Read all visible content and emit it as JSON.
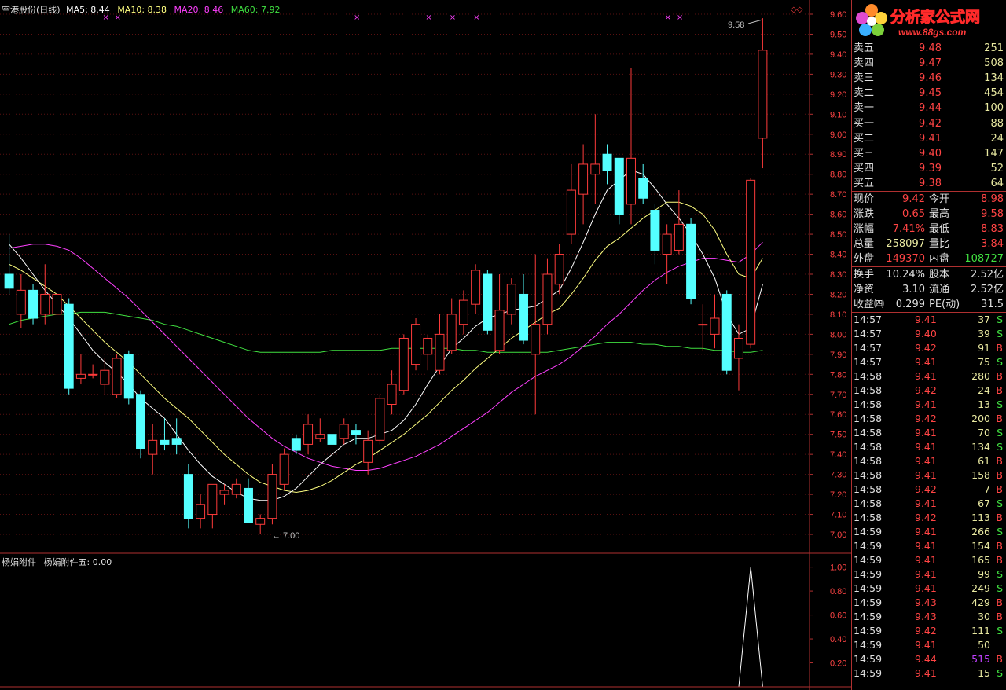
{
  "header": {
    "title": "空港股份(日线)",
    "ma5": "MA5: 8.44",
    "ma10": "MA10: 8.38",
    "ma20": "MA20: 8.46",
    "ma60": "MA60: 7.92",
    "ma5_color": "#ffffff",
    "ma10_color": "#ffff80",
    "ma20_color": "#ff40ff",
    "ma60_color": "#40e040"
  },
  "sub_header": {
    "indicator": "杨娟附件",
    "value": "杨娟附件五: 0.00"
  },
  "price_axis": [
    "9.60",
    "9.50",
    "9.40",
    "9.30",
    "9.20",
    "9.10",
    "9.00",
    "8.90",
    "8.80",
    "8.70",
    "8.60",
    "8.50",
    "8.40",
    "8.30",
    "8.20",
    "8.10",
    "8.00",
    "7.90",
    "7.80",
    "7.70",
    "7.60",
    "7.50",
    "7.40",
    "7.30",
    "7.20",
    "7.10",
    "7.00"
  ],
  "sub_axis": [
    "1.00",
    "0.80",
    "0.60",
    "0.40",
    "0.20"
  ],
  "annotations": {
    "high": "9.58",
    "low": "7.00"
  },
  "logo": {
    "text": "分析家公式网",
    "url": "www.88gs.com"
  },
  "order_book": {
    "asks": [
      {
        "label": "卖五",
        "price": "9.48",
        "qty": "251"
      },
      {
        "label": "卖四",
        "price": "9.47",
        "qty": "508"
      },
      {
        "label": "卖三",
        "price": "9.46",
        "qty": "134"
      },
      {
        "label": "卖二",
        "price": "9.45",
        "qty": "454"
      },
      {
        "label": "卖一",
        "price": "9.44",
        "qty": "100"
      }
    ],
    "bids": [
      {
        "label": "买一",
        "price": "9.42",
        "qty": "88"
      },
      {
        "label": "买二",
        "price": "9.41",
        "qty": "24"
      },
      {
        "label": "买三",
        "price": "9.40",
        "qty": "147"
      },
      {
        "label": "买四",
        "price": "9.39",
        "qty": "52"
      },
      {
        "label": "买五",
        "price": "9.38",
        "qty": "64"
      }
    ]
  },
  "quote": [
    {
      "l": "现价",
      "lv": "9.42",
      "lc": "#ff4444",
      "r": "今开",
      "rv": "8.98",
      "rc": "#ff4444"
    },
    {
      "l": "涨跌",
      "lv": "0.65",
      "lc": "#ff4444",
      "r": "最高",
      "rv": "9.58",
      "rc": "#ff4444"
    },
    {
      "l": "涨幅",
      "lv": "7.41%",
      "lc": "#ff4444",
      "r": "最低",
      "rv": "8.83",
      "rc": "#ff4444"
    },
    {
      "l": "总量",
      "lv": "258097",
      "lc": "#e8e8a0",
      "r": "量比",
      "rv": "3.84",
      "rc": "#ff4444"
    },
    {
      "l": "外盘",
      "lv": "149370",
      "lc": "#ff4444",
      "r": "内盘",
      "rv": "108727",
      "rc": "#40e040"
    }
  ],
  "fundamentals": [
    {
      "l": "换手",
      "lv": "10.24%",
      "lc": "#e0e0e0",
      "r": "股本",
      "rv": "2.52亿",
      "rc": "#e0e0e0"
    },
    {
      "l": "净资",
      "lv": "3.10",
      "lc": "#e0e0e0",
      "r": "流通",
      "rv": "2.52亿",
      "rc": "#e0e0e0"
    },
    {
      "l": "收益㈣",
      "lv": "0.299",
      "lc": "#e0e0e0",
      "r": "PE(动)",
      "rv": "31.5",
      "rc": "#e0e0e0"
    }
  ],
  "ticks": [
    {
      "time": "14:57",
      "price": "9.41",
      "vol": "37",
      "side": "S"
    },
    {
      "time": "14:57",
      "price": "9.40",
      "vol": "39",
      "side": "S"
    },
    {
      "time": "14:57",
      "price": "9.42",
      "vol": "91",
      "side": "B"
    },
    {
      "time": "14:57",
      "price": "9.41",
      "vol": "75",
      "side": "S"
    },
    {
      "time": "14:58",
      "price": "9.41",
      "vol": "280",
      "side": "B"
    },
    {
      "time": "14:58",
      "price": "9.42",
      "vol": "24",
      "side": "B"
    },
    {
      "time": "14:58",
      "price": "9.41",
      "vol": "13",
      "side": "S"
    },
    {
      "time": "14:58",
      "price": "9.42",
      "vol": "200",
      "side": "B"
    },
    {
      "time": "14:58",
      "price": "9.41",
      "vol": "70",
      "side": "S"
    },
    {
      "time": "14:58",
      "price": "9.41",
      "vol": "134",
      "side": "S"
    },
    {
      "time": "14:58",
      "price": "9.41",
      "vol": "61",
      "side": "B"
    },
    {
      "time": "14:58",
      "price": "9.41",
      "vol": "158",
      "side": "B"
    },
    {
      "time": "14:58",
      "price": "9.42",
      "vol": "7",
      "side": "B"
    },
    {
      "time": "14:58",
      "price": "9.41",
      "vol": "67",
      "side": "S"
    },
    {
      "time": "14:58",
      "price": "9.42",
      "vol": "113",
      "side": "B"
    },
    {
      "time": "14:59",
      "price": "9.41",
      "vol": "266",
      "side": "S"
    },
    {
      "time": "14:59",
      "price": "9.41",
      "vol": "154",
      "side": "B"
    },
    {
      "time": "14:59",
      "price": "9.41",
      "vol": "165",
      "side": "B"
    },
    {
      "time": "14:59",
      "price": "9.41",
      "vol": "99",
      "side": "S"
    },
    {
      "time": "14:59",
      "price": "9.41",
      "vol": "249",
      "side": "S"
    },
    {
      "time": "14:59",
      "price": "9.43",
      "vol": "429",
      "side": "B"
    },
    {
      "time": "14:59",
      "price": "9.43",
      "vol": "30",
      "side": "B"
    },
    {
      "time": "14:59",
      "price": "9.42",
      "vol": "111",
      "side": "S"
    },
    {
      "time": "14:59",
      "price": "9.41",
      "vol": "50",
      "side": ""
    },
    {
      "time": "14:59",
      "price": "9.44",
      "vol": "515",
      "side": "B"
    },
    {
      "time": "14:59",
      "price": "9.41",
      "vol": "15",
      "side": "S"
    }
  ],
  "chart_data": {
    "type": "candlestick",
    "ylim": [
      7.0,
      9.6
    ],
    "candles": [
      {
        "o": 8.3,
        "h": 8.5,
        "l": 8.2,
        "c": 8.23
      },
      {
        "o": 8.1,
        "h": 8.3,
        "l": 8.03,
        "c": 8.22
      },
      {
        "o": 8.22,
        "h": 8.25,
        "l": 8.05,
        "c": 8.08
      },
      {
        "o": 8.1,
        "h": 8.35,
        "l": 8.05,
        "c": 8.2
      },
      {
        "o": 8.1,
        "h": 8.25,
        "l": 8.0,
        "c": 8.2
      },
      {
        "o": 8.15,
        "h": 8.18,
        "l": 7.7,
        "c": 7.73
      },
      {
        "o": 7.78,
        "h": 7.9,
        "l": 7.75,
        "c": 7.8
      },
      {
        "o": 7.8,
        "h": 7.85,
        "l": 7.78,
        "c": 7.8
      },
      {
        "o": 7.75,
        "h": 7.88,
        "l": 7.7,
        "c": 7.82
      },
      {
        "o": 7.7,
        "h": 7.9,
        "l": 7.68,
        "c": 7.88
      },
      {
        "o": 7.9,
        "h": 7.92,
        "l": 7.65,
        "c": 7.68
      },
      {
        "o": 7.7,
        "h": 7.72,
        "l": 7.38,
        "c": 7.43
      },
      {
        "o": 7.4,
        "h": 7.55,
        "l": 7.3,
        "c": 7.47
      },
      {
        "o": 7.47,
        "h": 7.58,
        "l": 7.42,
        "c": 7.45
      },
      {
        "o": 7.48,
        "h": 7.58,
        "l": 7.4,
        "c": 7.45
      },
      {
        "o": 7.3,
        "h": 7.35,
        "l": 7.03,
        "c": 7.08
      },
      {
        "o": 7.08,
        "h": 7.2,
        "l": 7.03,
        "c": 7.15
      },
      {
        "o": 7.1,
        "h": 7.25,
        "l": 7.03,
        "c": 7.25
      },
      {
        "o": 7.2,
        "h": 7.25,
        "l": 7.15,
        "c": 7.22
      },
      {
        "o": 7.2,
        "h": 7.28,
        "l": 7.18,
        "c": 7.25
      },
      {
        "o": 7.23,
        "h": 7.28,
        "l": 7.06,
        "c": 7.06
      },
      {
        "o": 7.05,
        "h": 7.1,
        "l": 7.0,
        "c": 7.08
      },
      {
        "o": 7.08,
        "h": 7.35,
        "l": 7.05,
        "c": 7.3
      },
      {
        "o": 7.25,
        "h": 7.43,
        "l": 7.22,
        "c": 7.4
      },
      {
        "o": 7.48,
        "h": 7.5,
        "l": 7.4,
        "c": 7.42
      },
      {
        "o": 7.45,
        "h": 7.6,
        "l": 7.4,
        "c": 7.55
      },
      {
        "o": 7.48,
        "h": 7.58,
        "l": 7.46,
        "c": 7.5
      },
      {
        "o": 7.5,
        "h": 7.52,
        "l": 7.44,
        "c": 7.45
      },
      {
        "o": 7.48,
        "h": 7.58,
        "l": 7.45,
        "c": 7.55
      },
      {
        "o": 7.52,
        "h": 7.55,
        "l": 7.45,
        "c": 7.5
      },
      {
        "o": 7.36,
        "h": 7.52,
        "l": 7.3,
        "c": 7.47
      },
      {
        "o": 7.47,
        "h": 7.7,
        "l": 7.45,
        "c": 7.68
      },
      {
        "o": 7.65,
        "h": 7.82,
        "l": 7.6,
        "c": 7.75
      },
      {
        "o": 7.72,
        "h": 8.0,
        "l": 7.7,
        "c": 7.98
      },
      {
        "o": 7.85,
        "h": 8.08,
        "l": 7.82,
        "c": 8.05
      },
      {
        "o": 7.9,
        "h": 8.0,
        "l": 7.82,
        "c": 7.98
      },
      {
        "o": 7.82,
        "h": 8.1,
        "l": 7.8,
        "c": 8.0
      },
      {
        "o": 7.92,
        "h": 8.18,
        "l": 7.9,
        "c": 8.1
      },
      {
        "o": 8.05,
        "h": 8.22,
        "l": 8.0,
        "c": 8.17
      },
      {
        "o": 8.15,
        "h": 8.35,
        "l": 8.1,
        "c": 8.32
      },
      {
        "o": 8.3,
        "h": 8.32,
        "l": 8.0,
        "c": 8.02
      },
      {
        "o": 7.92,
        "h": 8.3,
        "l": 7.9,
        "c": 8.12
      },
      {
        "o": 8.1,
        "h": 8.28,
        "l": 8.05,
        "c": 8.25
      },
      {
        "o": 8.2,
        "h": 8.3,
        "l": 7.95,
        "c": 7.97
      },
      {
        "o": 7.9,
        "h": 8.4,
        "l": 7.6,
        "c": 8.05
      },
      {
        "o": 8.05,
        "h": 8.38,
        "l": 8.0,
        "c": 8.3
      },
      {
        "o": 8.25,
        "h": 8.45,
        "l": 8.2,
        "c": 8.4
      },
      {
        "o": 8.5,
        "h": 8.85,
        "l": 8.45,
        "c": 8.72
      },
      {
        "o": 8.7,
        "h": 8.95,
        "l": 8.55,
        "c": 8.85
      },
      {
        "o": 8.8,
        "h": 9.1,
        "l": 8.65,
        "c": 8.85
      },
      {
        "o": 8.9,
        "h": 8.95,
        "l": 8.75,
        "c": 8.82
      },
      {
        "o": 8.88,
        "h": 8.88,
        "l": 8.55,
        "c": 8.6
      },
      {
        "o": 8.65,
        "h": 9.33,
        "l": 8.55,
        "c": 8.88
      },
      {
        "o": 8.78,
        "h": 8.85,
        "l": 8.65,
        "c": 8.68
      },
      {
        "o": 8.62,
        "h": 8.65,
        "l": 8.35,
        "c": 8.42
      },
      {
        "o": 8.4,
        "h": 8.55,
        "l": 8.25,
        "c": 8.5
      },
      {
        "o": 8.42,
        "h": 8.72,
        "l": 8.4,
        "c": 8.55
      },
      {
        "o": 8.55,
        "h": 8.58,
        "l": 8.15,
        "c": 8.18
      },
      {
        "o": 8.05,
        "h": 8.15,
        "l": 7.92,
        "c": 8.05
      },
      {
        "o": 8.0,
        "h": 8.2,
        "l": 7.93,
        "c": 8.08
      },
      {
        "o": 8.2,
        "h": 8.22,
        "l": 7.8,
        "c": 7.82
      },
      {
        "o": 7.88,
        "h": 8.05,
        "l": 7.72,
        "c": 7.98
      },
      {
        "o": 7.95,
        "h": 8.78,
        "l": 7.93,
        "c": 8.77
      },
      {
        "o": 8.98,
        "h": 9.58,
        "l": 8.83,
        "c": 9.42
      }
    ],
    "ma5": [
      8.45,
      8.38,
      8.3,
      8.22,
      8.15,
      8.08,
      8.0,
      7.92,
      7.86,
      7.81,
      7.75,
      7.68,
      7.63,
      7.58,
      7.5,
      7.42,
      7.35,
      7.29,
      7.25,
      7.21,
      7.18,
      7.17,
      7.17,
      7.19,
      7.23,
      7.29,
      7.35,
      7.4,
      7.45,
      7.48,
      7.48,
      7.5,
      7.52,
      7.57,
      7.65,
      7.75,
      7.84,
      7.93,
      7.98,
      8.04,
      8.08,
      8.1,
      8.12,
      8.13,
      8.14,
      8.18,
      8.22,
      8.33,
      8.46,
      8.6,
      8.72,
      8.77,
      8.82,
      8.8,
      8.73,
      8.65,
      8.58,
      8.5,
      8.4,
      8.28,
      8.1,
      8.0,
      8.03,
      8.25
    ],
    "ma10": [
      8.35,
      8.32,
      8.28,
      8.24,
      8.2,
      8.14,
      8.08,
      8.02,
      7.96,
      7.91,
      7.86,
      7.8,
      7.74,
      7.68,
      7.63,
      7.58,
      7.52,
      7.46,
      7.4,
      7.35,
      7.3,
      7.26,
      7.24,
      7.22,
      7.21,
      7.22,
      7.24,
      7.27,
      7.31,
      7.35,
      7.38,
      7.42,
      7.46,
      7.5,
      7.55,
      7.6,
      7.66,
      7.72,
      7.77,
      7.83,
      7.88,
      7.93,
      7.98,
      8.02,
      8.06,
      8.1,
      8.13,
      8.2,
      8.28,
      8.37,
      8.44,
      8.48,
      8.53,
      8.58,
      8.62,
      8.66,
      8.66,
      8.64,
      8.6,
      8.52,
      8.4,
      8.3,
      8.28,
      8.38
    ],
    "ma20": [
      8.43,
      8.44,
      8.45,
      8.45,
      8.44,
      8.42,
      8.38,
      8.33,
      8.28,
      8.23,
      8.18,
      8.12,
      8.06,
      8.0,
      7.94,
      7.88,
      7.82,
      7.76,
      7.7,
      7.64,
      7.58,
      7.53,
      7.48,
      7.44,
      7.41,
      7.38,
      7.36,
      7.34,
      7.33,
      7.32,
      7.32,
      7.33,
      7.35,
      7.37,
      7.39,
      7.42,
      7.45,
      7.49,
      7.53,
      7.57,
      7.61,
      7.66,
      7.71,
      7.75,
      7.79,
      7.82,
      7.85,
      7.89,
      7.94,
      7.99,
      8.05,
      8.1,
      8.16,
      8.22,
      8.27,
      8.31,
      8.34,
      8.36,
      8.38,
      8.38,
      8.37,
      8.36,
      8.4,
      8.46
    ],
    "ma60": [
      8.05,
      8.07,
      8.08,
      8.09,
      8.1,
      8.1,
      8.11,
      8.11,
      8.11,
      8.1,
      8.09,
      8.08,
      8.07,
      8.05,
      8.04,
      8.02,
      8.0,
      7.98,
      7.96,
      7.94,
      7.92,
      7.91,
      7.91,
      7.91,
      7.91,
      7.91,
      7.91,
      7.92,
      7.92,
      7.92,
      7.92,
      7.92,
      7.93,
      7.93,
      7.93,
      7.93,
      7.93,
      7.93,
      7.92,
      7.92,
      7.91,
      7.91,
      7.91,
      7.91,
      7.91,
      7.91,
      7.92,
      7.93,
      7.94,
      7.95,
      7.96,
      7.96,
      7.96,
      7.95,
      7.95,
      7.94,
      7.94,
      7.93,
      7.93,
      7.92,
      7.92,
      7.91,
      7.91,
      7.92
    ],
    "signals_x": [
      8,
      9,
      29,
      35,
      37,
      39,
      55,
      56
    ],
    "indicator": {
      "ylim": [
        0,
        1.05
      ],
      "values_tail": [
        0,
        1,
        0
      ]
    }
  }
}
